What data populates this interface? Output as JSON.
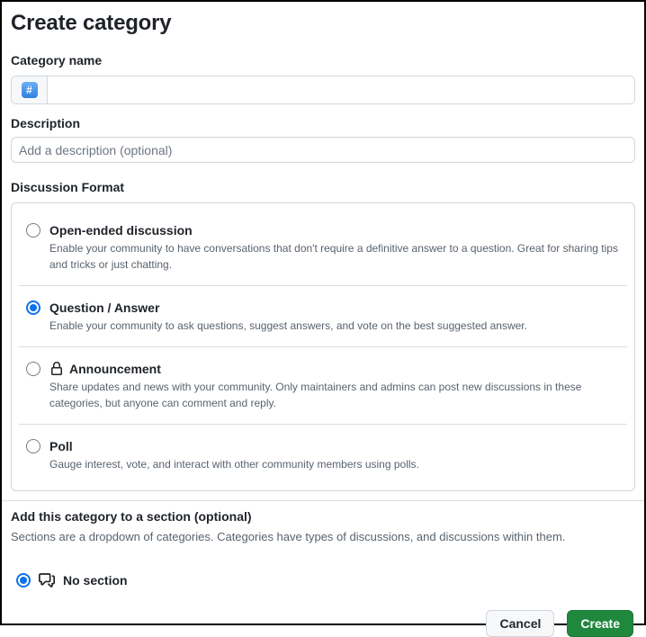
{
  "dialog": {
    "title": "Create category",
    "category_name": {
      "label": "Category name",
      "value": "",
      "emoji_char": "#",
      "emoji_icon": "hash-keycap-emoji"
    },
    "description": {
      "label": "Description",
      "placeholder": "Add a description (optional)"
    },
    "discussion_format": {
      "label": "Discussion Format",
      "options": [
        {
          "title": "Open-ended discussion",
          "description": "Enable your community to have conversations that don't require a definitive answer to a question. Great for sharing tips and tricks or just chatting.",
          "selected": false,
          "icon": ""
        },
        {
          "title": "Question / Answer",
          "description": "Enable your community to ask questions, suggest answers, and vote on the best suggested answer.",
          "selected": true,
          "icon": ""
        },
        {
          "title": "Announcement",
          "description": "Share updates and news with your community. Only maintainers and admins can post new discussions in these categories, but anyone can comment and reply.",
          "selected": false,
          "icon": "lock-icon"
        },
        {
          "title": "Poll",
          "description": "Gauge interest, vote, and interact with other community members using polls.",
          "selected": false,
          "icon": ""
        }
      ]
    },
    "section": {
      "heading": "Add this category to a section (optional)",
      "note": "Sections are a dropdown of categories. Categories have types of discussions, and discussions within them.",
      "option": {
        "label": "No section",
        "selected": true,
        "icon": "comment-discussion-icon"
      }
    },
    "footer": {
      "cancel_label": "Cancel",
      "create_label": "Create"
    },
    "colors": {
      "accent_blue": "#0d72ea",
      "create_green": "#1f883d",
      "border": "#d0d7de",
      "text": "#1f2328",
      "muted_text": "#59636e"
    }
  }
}
